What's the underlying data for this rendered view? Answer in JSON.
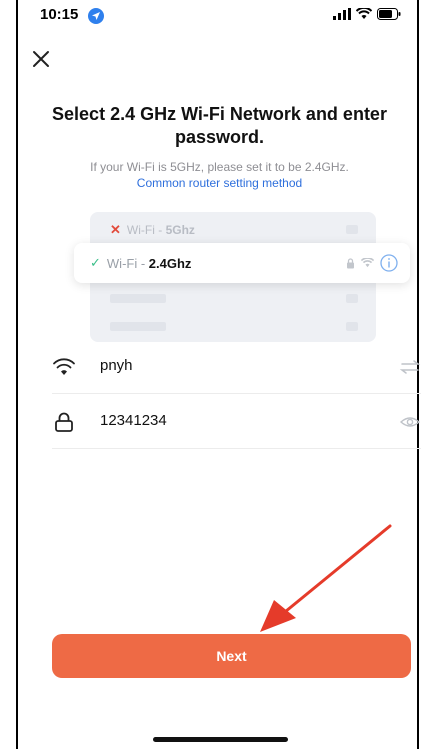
{
  "status_bar": {
    "time": "10:15",
    "icons": [
      "location-arrow-icon",
      "signal-bars-icon",
      "wifi-icon",
      "battery-icon"
    ]
  },
  "header": {
    "close_icon": "close-icon",
    "title": "Select 2.4 GHz Wi-Fi Network and enter password.",
    "subtitle": "If your Wi-Fi is 5GHz, please set it to be 2.4GHz.",
    "help_link": "Common router setting method"
  },
  "illustration": {
    "bad_prefix": "Wi-Fi - ",
    "bad_band": "5Ghz",
    "good_prefix": "Wi-Fi - ",
    "good_band": "2.4Ghz"
  },
  "form": {
    "network_name": "pnyh",
    "password": "12341234",
    "network_icon": "wifi-icon",
    "password_icon": "lock-icon",
    "switch_icon": "switch-network-icon",
    "visibility_icon": "eye-icon"
  },
  "actions": {
    "next_label": "Next"
  },
  "colors": {
    "accent": "#ee6a45",
    "link": "#2e6fdc",
    "success": "#3bbf8a",
    "error": "#e24b3c"
  }
}
